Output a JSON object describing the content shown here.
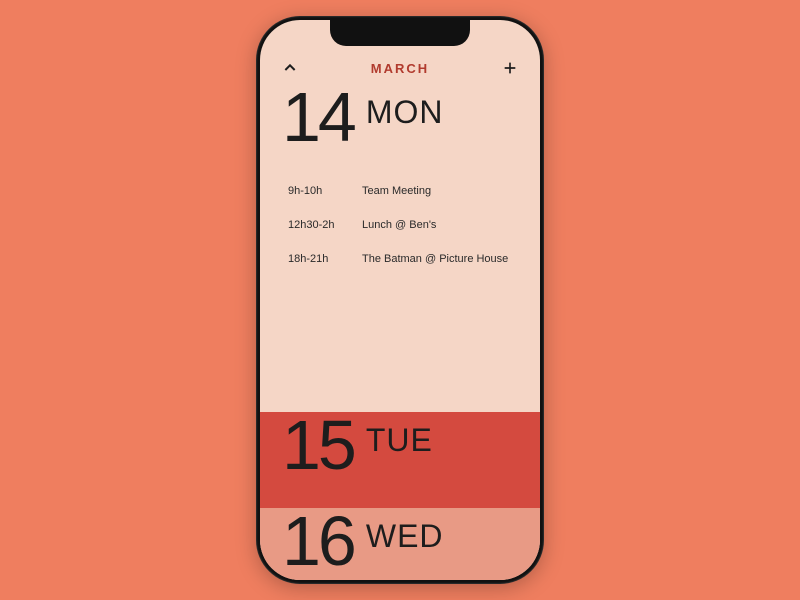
{
  "header": {
    "month_label": "MARCH"
  },
  "days": [
    {
      "number": "14",
      "weekday": "MON",
      "events": [
        {
          "time": "9h-10h",
          "title": "Team Meeting"
        },
        {
          "time": "12h30-2h",
          "title": "Lunch @ Ben's"
        },
        {
          "time": "18h-21h",
          "title": "The Batman @ Picture House"
        }
      ]
    },
    {
      "number": "15",
      "weekday": "TUE"
    },
    {
      "number": "16",
      "weekday": "WED"
    }
  ],
  "colors": {
    "page_bg": "#ef7e5f",
    "today_bg": "#f5d6c6",
    "tomorrow_bg": "#d44a3f",
    "after_bg": "#e89a85",
    "accent": "#b13b2e",
    "text": "#1d1d1d"
  }
}
